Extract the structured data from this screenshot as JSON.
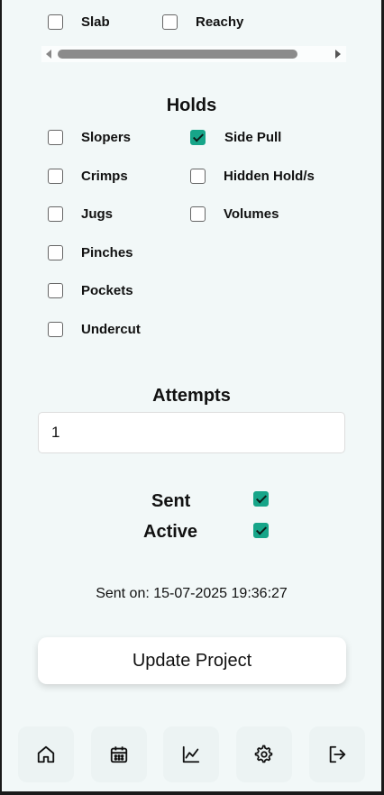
{
  "top_row": {
    "items": [
      {
        "label": "Slab",
        "checked": false
      },
      {
        "label": "Reachy",
        "checked": false
      }
    ]
  },
  "holds": {
    "title": "Holds",
    "left": [
      {
        "label": "Slopers",
        "checked": false
      },
      {
        "label": "Crimps",
        "checked": false
      },
      {
        "label": "Jugs",
        "checked": false
      },
      {
        "label": "Pinches",
        "checked": false
      },
      {
        "label": "Pockets",
        "checked": false
      },
      {
        "label": "Undercut",
        "checked": false
      }
    ],
    "right": [
      {
        "label": "Side Pull",
        "checked": true
      },
      {
        "label": "Hidden Hold/s",
        "checked": false
      },
      {
        "label": "Volumes",
        "checked": false
      }
    ]
  },
  "attempts": {
    "title": "Attempts",
    "value": "1"
  },
  "status": {
    "sent_label": "Sent",
    "sent_checked": true,
    "active_label": "Active",
    "active_checked": true
  },
  "sent_on": "Sent on: 15-07-2025 19:36:27",
  "update_button": "Update Project",
  "accent_color": "#17a589",
  "nav": [
    "home-icon",
    "calendar-icon",
    "chart-icon",
    "gear-icon",
    "logout-icon"
  ]
}
